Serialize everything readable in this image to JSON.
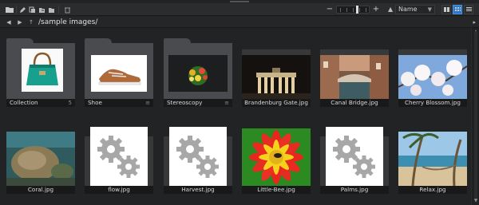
{
  "toolbar": {
    "zoom_minus": "−",
    "zoom_plus": "+",
    "zoom_level_percent": 60,
    "sort_direction": "▲",
    "sort_field": "Name",
    "view_modes": [
      "grid-large",
      "grid-small",
      "list"
    ],
    "active_view": "grid-small"
  },
  "path": {
    "back": "◀",
    "forward": "▶",
    "up": "↑",
    "current": "/sample images/",
    "right_arrow": "▸"
  },
  "items": [
    {
      "name": "Collection",
      "type": "folder",
      "badge": "5"
    },
    {
      "name": "Shoe",
      "type": "folder",
      "badge": "≡"
    },
    {
      "name": "Stereoscopy",
      "type": "folder",
      "badge": "≡"
    },
    {
      "name": "Brandenburg Gate.jpg",
      "type": "image"
    },
    {
      "name": "Canal Bridge.jpg",
      "type": "image"
    },
    {
      "name": "Cherry Blossom.jpg",
      "type": "image"
    },
    {
      "name": "Coral.jpg",
      "type": "image"
    },
    {
      "name": "flow.jpg",
      "type": "placeholder"
    },
    {
      "name": "Harvest.jpg",
      "type": "placeholder"
    },
    {
      "name": "Little-Bee.jpg",
      "type": "image"
    },
    {
      "name": "Palms.jpg",
      "type": "placeholder"
    },
    {
      "name": "Relax.jpg",
      "type": "image"
    }
  ],
  "colors": {
    "background": "#222325",
    "toolbar": "#2b2c2e",
    "accent": "#2d79c7",
    "caption_bg": "#19191a",
    "folder": "#4a4b4e"
  }
}
